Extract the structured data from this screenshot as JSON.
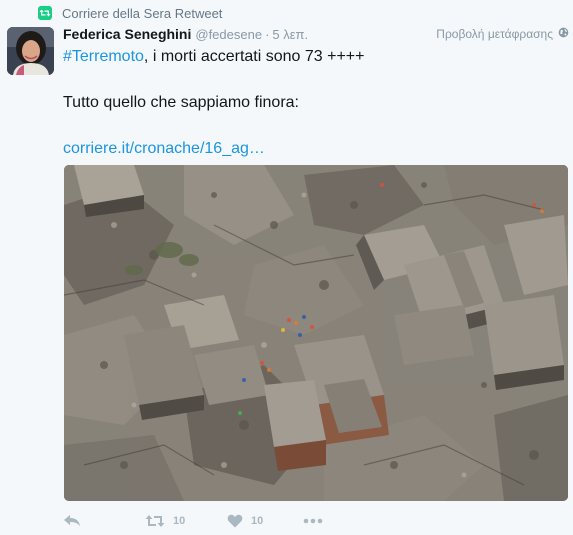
{
  "context": {
    "retweeted_by": "Corriere della Sera Retweet",
    "icon": "retweet-icon"
  },
  "author": {
    "fullname": "Federica Seneghini",
    "username": "@fedesene",
    "separator": "·",
    "time": "5 λεπ."
  },
  "translate": {
    "label": "Προβολή μετάφρασης",
    "icon": "globe-icon"
  },
  "tweet": {
    "hashtag": "#Terremoto",
    "line1_rest": ", i morti accertati sono 73 ++++",
    "line2": "Tutto quello che sappiamo finora:",
    "link": "corriere.it/cronache/16_ag…"
  },
  "actions": {
    "reply": {
      "icon": "reply-icon"
    },
    "retweet": {
      "icon": "retweet-icon",
      "count": "10"
    },
    "like": {
      "icon": "heart-icon",
      "count": "10"
    },
    "more": {
      "icon": "more-icon"
    }
  },
  "colors": {
    "link": "#1b95e0",
    "retweet_green": "#19cf86",
    "muted": "#8899a6",
    "action_gray": "#aab8c2",
    "background": "#f5f8fa"
  }
}
